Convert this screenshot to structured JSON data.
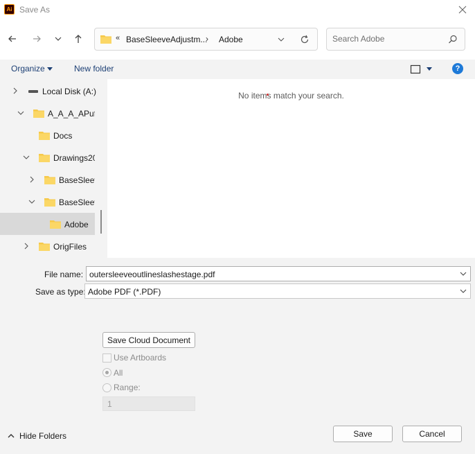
{
  "window": {
    "title": "Save As",
    "app_icon_text": "Ai"
  },
  "address_bar": {
    "overflow_chevron": "«",
    "crumb_1": "BaseSleeveAdjustm...",
    "separator": "›",
    "crumb_2": "Adobe"
  },
  "search": {
    "placeholder": "Search Adobe"
  },
  "toolbar": {
    "organize_label": "Organize",
    "new_folder_label": "New folder",
    "help_label": "?"
  },
  "tree": {
    "items": [
      {
        "label": "Local Disk (A:)",
        "icon": "drive-icon",
        "expanded": false
      },
      {
        "label": "A_A_A_APuff",
        "icon": "folder-icon",
        "expanded": true
      },
      {
        "label": "Docs",
        "icon": "folder-icon"
      },
      {
        "label": "Drawings20",
        "icon": "folder-icon",
        "expanded": true
      },
      {
        "label": "BaseSleev",
        "icon": "folder-icon",
        "expanded": false
      },
      {
        "label": "BaseSleev",
        "icon": "folder-icon",
        "expanded": true
      },
      {
        "label": "Adobe",
        "icon": "folder-icon",
        "selected": true
      },
      {
        "label": "OrigFiles",
        "icon": "folder-icon",
        "expanded": false
      }
    ]
  },
  "content": {
    "empty_message": "No items match your search."
  },
  "form": {
    "file_name_label": "File name:",
    "file_name_value": "outersleeveoutlineslashestage.pdf",
    "save_as_type_label": "Save as type:",
    "save_as_type_value": "Adobe PDF (*.PDF)",
    "cloud_button_label": "Save Cloud Document",
    "use_artboards_label": "Use Artboards",
    "all_label": "All",
    "range_label": "Range:",
    "range_value": "1"
  },
  "footer": {
    "hide_folders_label": "Hide Folders",
    "save_label": "Save",
    "cancel_label": "Cancel"
  },
  "colors": {
    "accent": "#1e7ad8",
    "folder": "#f6c94a",
    "link_text": "#1c3f74"
  }
}
